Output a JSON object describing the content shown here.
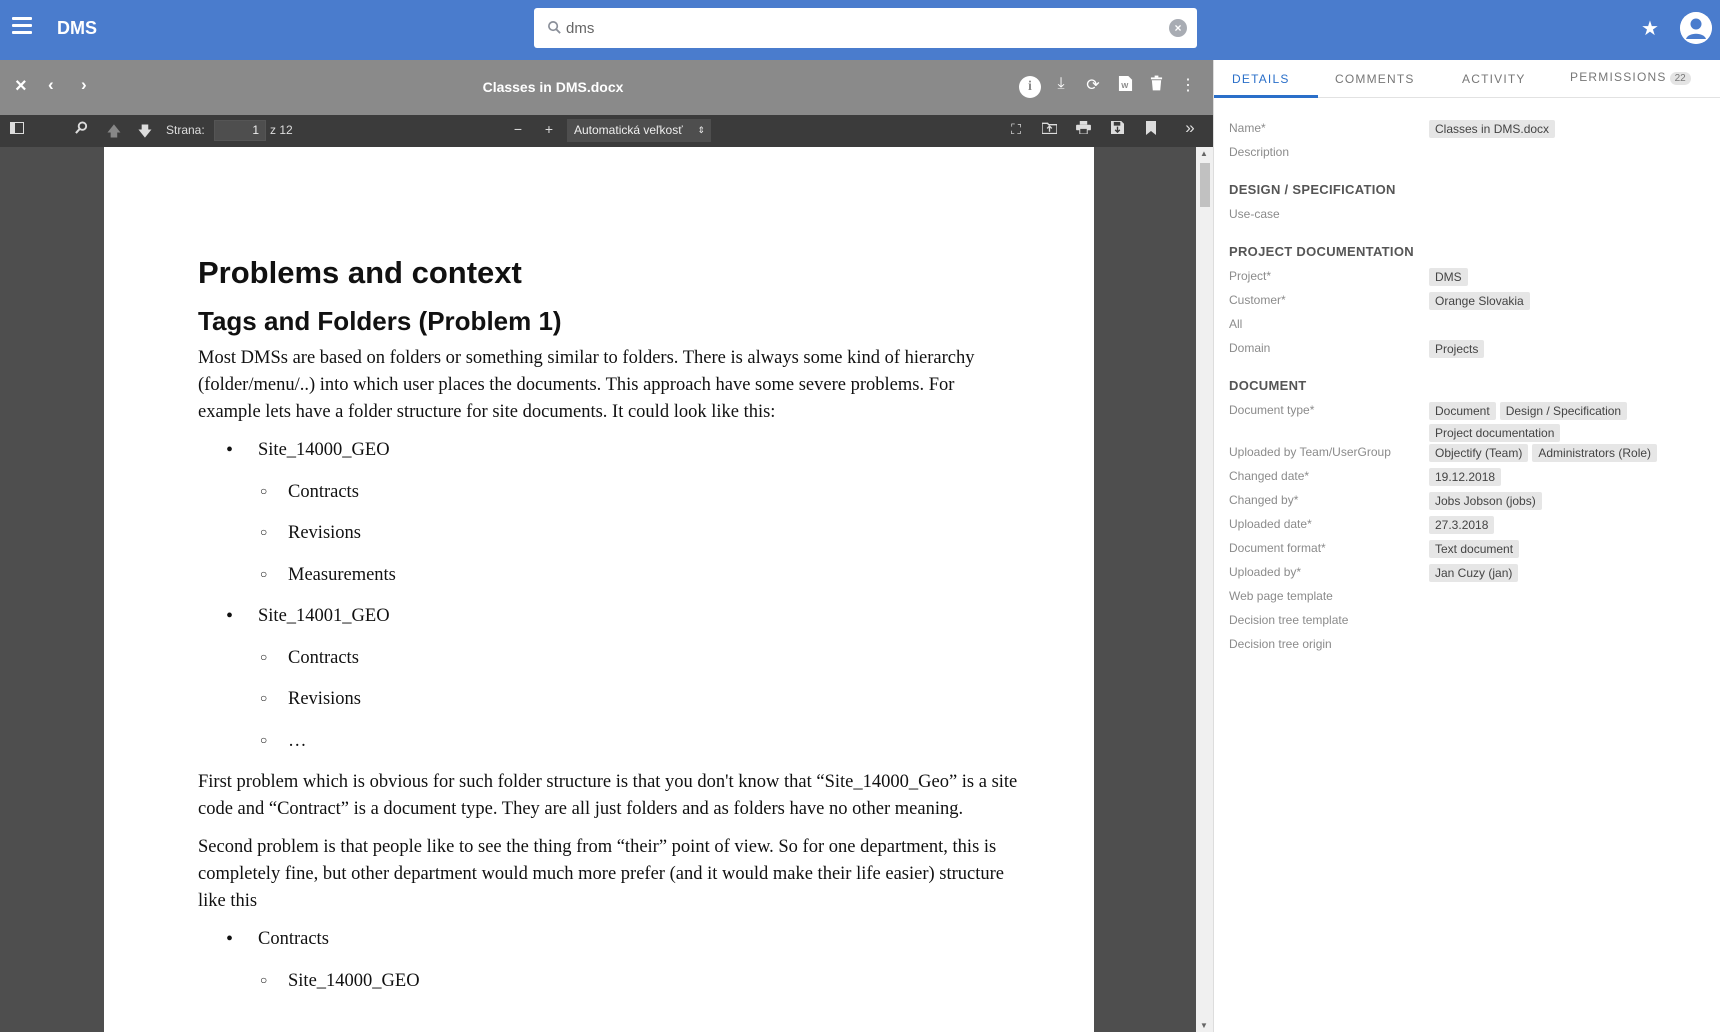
{
  "app": {
    "brand": "DMS",
    "search": {
      "value": "dms",
      "placeholder": ""
    }
  },
  "viewer": {
    "title": "Classes in DMS.docx",
    "toolbar": {
      "page_label": "Strana:",
      "page_value": "1",
      "page_total": "z 12",
      "zoom_value": "Automatická veľkosť"
    }
  },
  "document": {
    "h1": "Problems and context",
    "h2": "Tags and Folders (Problem 1)",
    "p1": "Most DMSs are based on folders or something similar to folders. There is always some kind of hierarchy (folder/menu/..) into which user places the documents. This approach have some severe problems. For example lets have a folder structure for site documents. It could look like this:",
    "list1": [
      {
        "level": 1,
        "text": "Site_14000_GEO"
      },
      {
        "level": 2,
        "text": "Contracts"
      },
      {
        "level": 2,
        "text": "Revisions"
      },
      {
        "level": 2,
        "text": "Measurements"
      },
      {
        "level": 1,
        "text": "Site_14001_GEO"
      },
      {
        "level": 2,
        "text": "Contracts"
      },
      {
        "level": 2,
        "text": "Revisions"
      },
      {
        "level": 2,
        "text": "…"
      }
    ],
    "p2": "First problem which is obvious for such folder structure is that you don't know that “Site_14000_Geo” is a site code and “Contract” is a document type. They are all just folders and as folders have no other meaning.",
    "p3": "Second problem is that people like to see the thing from “their” point of view. So for one department, this is completely fine, but other department would much more prefer (and it would make their life easier) structure like this",
    "list2": [
      {
        "level": 1,
        "text": "Contracts"
      },
      {
        "level": 2,
        "text": "Site_14000_GEO"
      }
    ]
  },
  "panel": {
    "tabs": [
      {
        "label": "DETAILS"
      },
      {
        "label": "COMMENTS"
      },
      {
        "label": "ACTIVITY"
      },
      {
        "label": "PERMISSIONS",
        "badge": "22"
      }
    ],
    "fields_top": [
      {
        "label": "Name*",
        "values": [
          "Classes in DMS.docx"
        ]
      },
      {
        "label": "Description",
        "values": []
      }
    ],
    "section_design": "DESIGN / SPECIFICATION",
    "fields_design": [
      {
        "label": "Use-case",
        "values": []
      }
    ],
    "section_project": "PROJECT DOCUMENTATION",
    "fields_project": [
      {
        "label": "Project*",
        "values": [
          "DMS"
        ]
      },
      {
        "label": "Customer*",
        "values": [
          "Orange Slovakia"
        ]
      },
      {
        "label": "All",
        "values": []
      },
      {
        "label": "Domain",
        "values": [
          "Projects"
        ]
      }
    ],
    "section_document": "DOCUMENT",
    "fields_document": [
      {
        "label": "Document type*",
        "values": [
          "Document",
          "Design / Specification",
          "Project documentation"
        ]
      },
      {
        "label": "Uploaded by Team/UserGroup",
        "values": [
          "Objectify (Team)",
          "Administrators (Role)"
        ]
      },
      {
        "label": "Changed date*",
        "values": [
          "19.12.2018"
        ]
      },
      {
        "label": "Changed by*",
        "values": [
          "Jobs Jobson (jobs)"
        ]
      },
      {
        "label": "Uploaded date*",
        "values": [
          "27.3.2018"
        ]
      },
      {
        "label": "Document format*",
        "values": [
          "Text document"
        ]
      },
      {
        "label": "Uploaded by*",
        "values": [
          "Jan Cuzy (jan)"
        ]
      },
      {
        "label": "Web page template",
        "values": []
      },
      {
        "label": "Decision tree template",
        "values": []
      },
      {
        "label": "Decision tree origin",
        "values": []
      }
    ]
  },
  "icons": [
    "menu-icon",
    "search-icon",
    "clear-icon",
    "star-icon",
    "account-icon",
    "close-icon",
    "chevron-left-icon",
    "chevron-right-icon",
    "info-icon",
    "download-icon",
    "refresh-icon",
    "word-icon",
    "delete-icon",
    "more-icon",
    "sidebar-toggle-icon",
    "find-icon",
    "previous-page-icon",
    "next-page-icon",
    "zoom-out-icon",
    "zoom-in-icon",
    "presentation-icon",
    "open-file-icon",
    "print-icon",
    "save-icon",
    "bookmark-icon",
    "tools-icon"
  ],
  "colors": {
    "topbar": "#4a7ccd",
    "accent": "#2a6fc9"
  }
}
